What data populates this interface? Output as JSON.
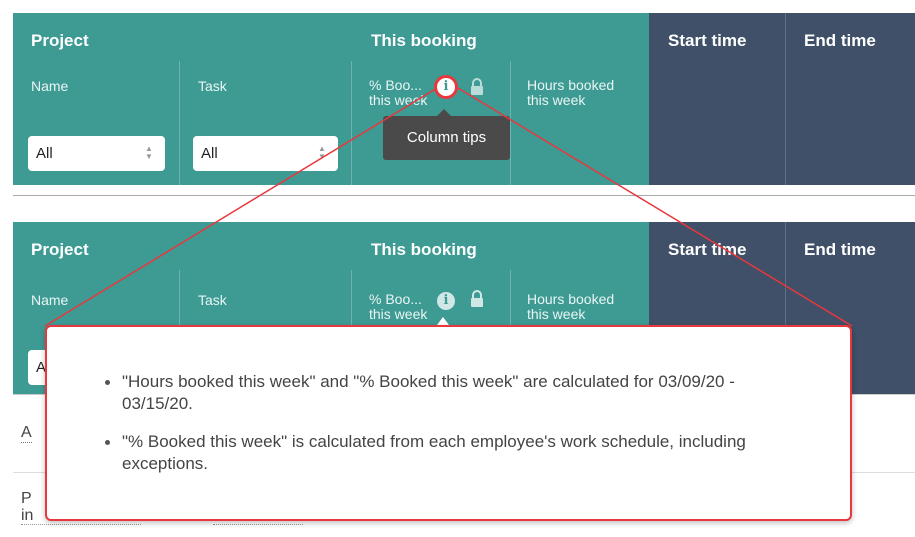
{
  "header": {
    "project": "Project",
    "this_booking": "This booking",
    "start_time": "Start time",
    "end_time": "End time"
  },
  "columns": {
    "name": "Name",
    "task": "Task",
    "pct_booked_line1": "% Boo...",
    "pct_booked_line2": "this week",
    "hours_booked_line1": "Hours booked",
    "hours_booked_line2": "this week"
  },
  "filters": {
    "name_value": "All",
    "task_value": "All"
  },
  "tooltip": {
    "label": "Column tips"
  },
  "bottom_rows": {
    "row1_stub": "A",
    "row2_stub_line1": "P",
    "row2_stub_line2": "in",
    "partial_select": "A"
  },
  "column_tips": [
    "\"Hours booked this week\" and \"% Booked this week\" are calculated for 03/09/20 - 03/15/20.",
    "\"% Booked this week\" is calculated from each employee's work schedule, including exceptions."
  ],
  "colors": {
    "teal": "#3d9b94",
    "navy": "#3f5068",
    "highlight_red": "#e8383d"
  }
}
